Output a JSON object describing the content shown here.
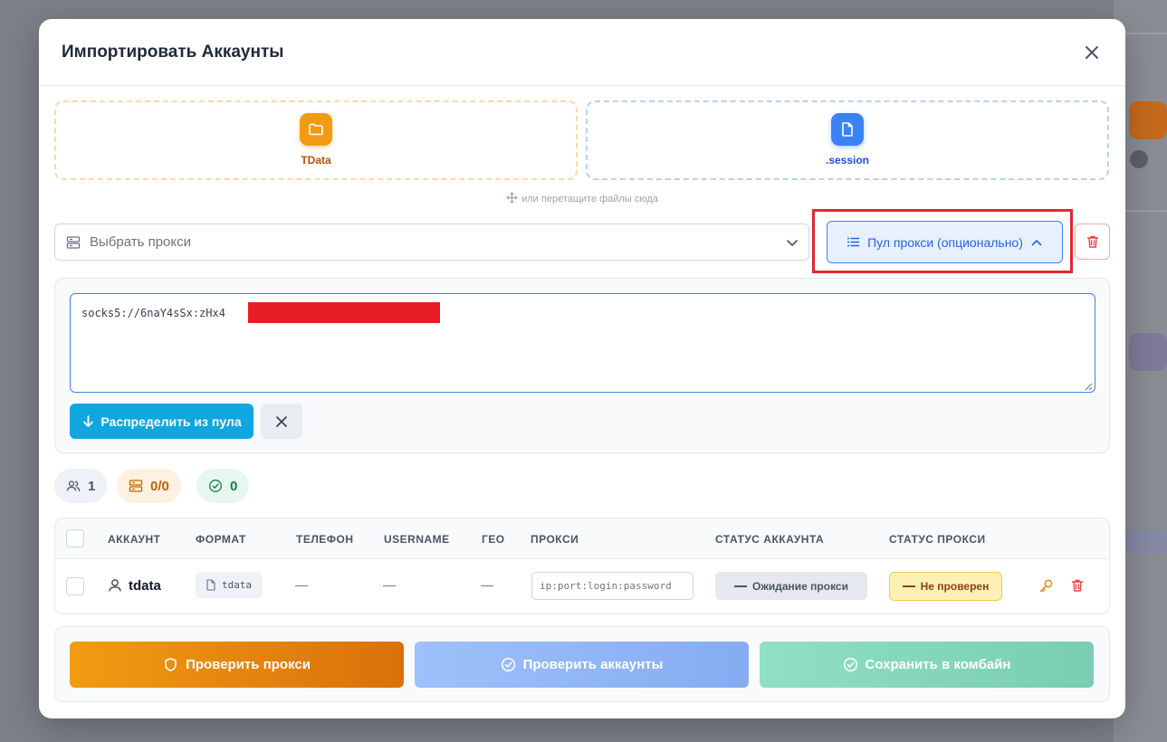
{
  "modal": {
    "title": "Импортировать Аккаунты"
  },
  "import": {
    "tdata_label": "TData",
    "session_label": ".session",
    "hint": "или перетащите файлы сюда"
  },
  "proxy": {
    "select_placeholder": "Выбрать прокси",
    "pool_button_label": "Пул прокси (опционально)",
    "pool_text": "socks5://6naY4sSx:zHx4",
    "distribute_label": "Распределить из пула"
  },
  "stats": {
    "accounts": "1",
    "proxies": "0/0",
    "valid": "0"
  },
  "table": {
    "headers": [
      "АККАУНТ",
      "ФОРМАТ",
      "ТЕЛЕФОН",
      "USERNAME",
      "ГЕО",
      "ПРОКСИ",
      "СТАТУС АККАУНТА",
      "СТАТУС ПРОКСИ"
    ],
    "rows": [
      {
        "account": "tdata",
        "format": "tdata",
        "phone": "—",
        "username": "—",
        "geo": "—",
        "proxy_placeholder": "ip:port:login:password",
        "account_status": "Ожидание прокси",
        "proxy_status": "Не проверен"
      }
    ]
  },
  "footer": {
    "check_proxy": "Проверить прокси",
    "check_accounts": "Проверить аккаунты",
    "save": "Сохранить в комбайн"
  },
  "colors": {
    "accent_orange": "#f29b12",
    "accent_blue": "#3b82f6",
    "accent_cyan": "#10a6e0",
    "danger": "#ef4444",
    "highlight_frame": "#e0282f"
  }
}
